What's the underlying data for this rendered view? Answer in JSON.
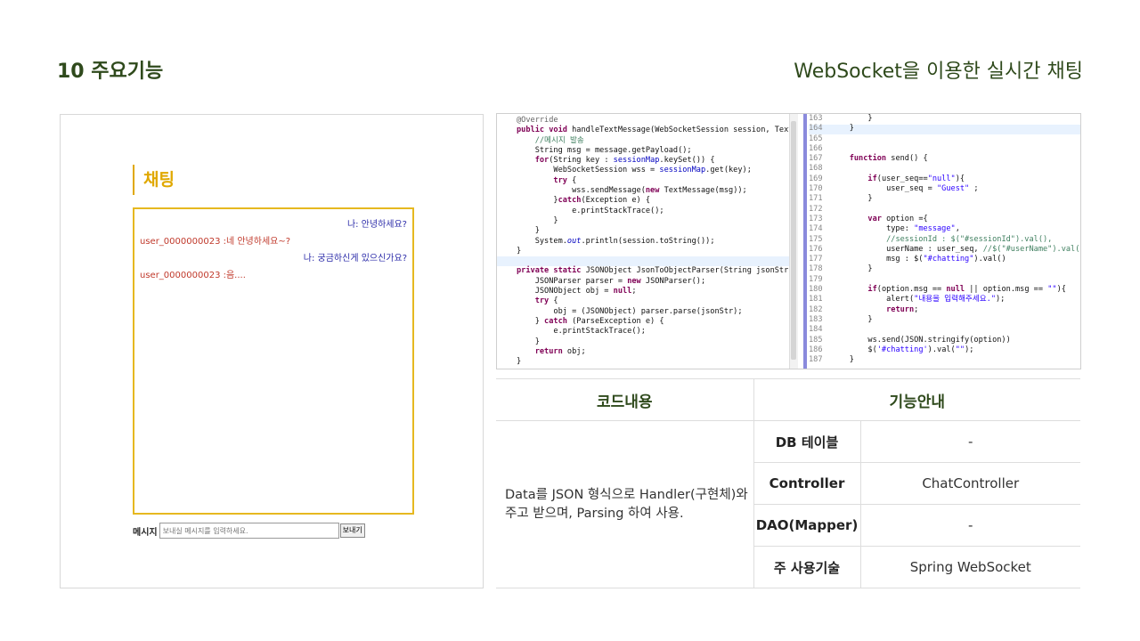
{
  "header": {
    "section_title": "10 주요기능",
    "subtitle": "WebSocket을 이용한 실시간 채팅"
  },
  "chat": {
    "heading": "채팅",
    "messages": [
      {
        "type": "mine",
        "text": "나: 안녕하세요?"
      },
      {
        "type": "other",
        "text": "user_0000000023 :네 안녕하세요~?"
      },
      {
        "type": "mine",
        "text": "나: 궁금하신게 있으신가요?"
      },
      {
        "type": "other",
        "text": "user_0000000023 :음...."
      }
    ],
    "input_label": "메시지",
    "input_placeholder": "보내실 메시지를 입력하세요.",
    "send_label": "보내기"
  },
  "code_panel": {
    "right_line_numbers": [
      "163",
      "164",
      "165",
      "166",
      "167",
      "168",
      "169",
      "170",
      "171",
      "172",
      "173",
      "174",
      "175",
      "176",
      "177",
      "178",
      "179",
      "180",
      "181",
      "182",
      "183",
      "184",
      "185",
      "186",
      "187"
    ]
  },
  "table": {
    "header_code": "코드내용",
    "header_feature": "기능안내",
    "description": "Data를 JSON 형식으로 Handler(구현체)와 주고 받으며, Parsing 하여 사용.",
    "rows": [
      {
        "label": "DB 테이블",
        "value": "-"
      },
      {
        "label": "Controller",
        "value": "ChatController"
      },
      {
        "label": "DAO(Mapper)",
        "value": "-"
      },
      {
        "label": "주 사용기술",
        "value": "Spring WebSocket"
      }
    ]
  },
  "colors": {
    "title": "#2f4a1c",
    "chat_accent": "#e0a800",
    "mine_message": "#2a2aa8",
    "other_message": "#c0392b"
  }
}
